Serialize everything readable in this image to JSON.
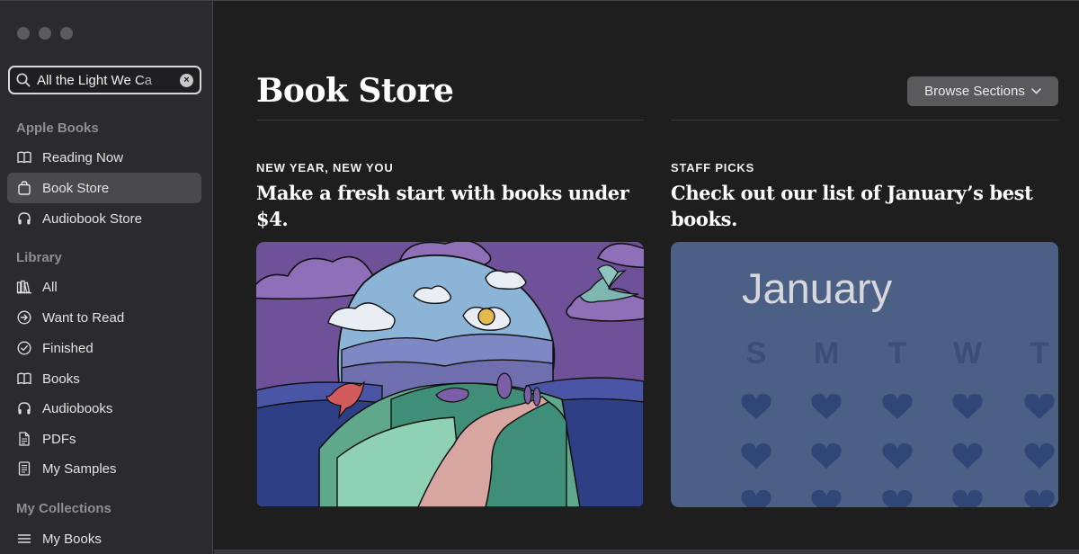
{
  "sidebar": {
    "search": {
      "value": "All the Light We Ca",
      "clear_label": "×"
    },
    "sections": [
      {
        "heading": "Apple Books",
        "items": [
          {
            "label": "Reading Now",
            "icon": "book-open-icon"
          },
          {
            "label": "Book Store",
            "icon": "bag-icon",
            "active": true
          },
          {
            "label": "Audiobook Store",
            "icon": "headphones-icon"
          }
        ]
      },
      {
        "heading": "Library",
        "items": [
          {
            "label": "All",
            "icon": "books-icon"
          },
          {
            "label": "Want to Read",
            "icon": "arrow-circle-icon"
          },
          {
            "label": "Finished",
            "icon": "check-circle-icon"
          },
          {
            "label": "Books",
            "icon": "book-open-icon"
          },
          {
            "label": "Audiobooks",
            "icon": "headphones-icon"
          },
          {
            "label": "PDFs",
            "icon": "document-icon"
          },
          {
            "label": "My Samples",
            "icon": "sample-icon"
          }
        ]
      },
      {
        "heading": "My Collections",
        "items": [
          {
            "label": "My Books",
            "icon": "list-icon"
          }
        ]
      }
    ]
  },
  "main": {
    "title": "Book Store",
    "browse_button": "Browse Sections",
    "cards": [
      {
        "eyebrow": "NEW YEAR, NEW YOU",
        "headline": "Make a fresh start with books under $4."
      },
      {
        "eyebrow": "STAFF PICKS",
        "headline": "Check out our list of January’s best books.",
        "calendar": {
          "month": "January",
          "days": [
            "S",
            "M",
            "T",
            "W",
            "T"
          ]
        }
      }
    ]
  },
  "colors": {
    "sidebar_bg": "#2b2b2d",
    "main_bg": "#1e1e1e",
    "selected_bg": "#4a4a4c",
    "calendar_bg": "#4c5f84",
    "calendar_heart": "#2f4676"
  }
}
